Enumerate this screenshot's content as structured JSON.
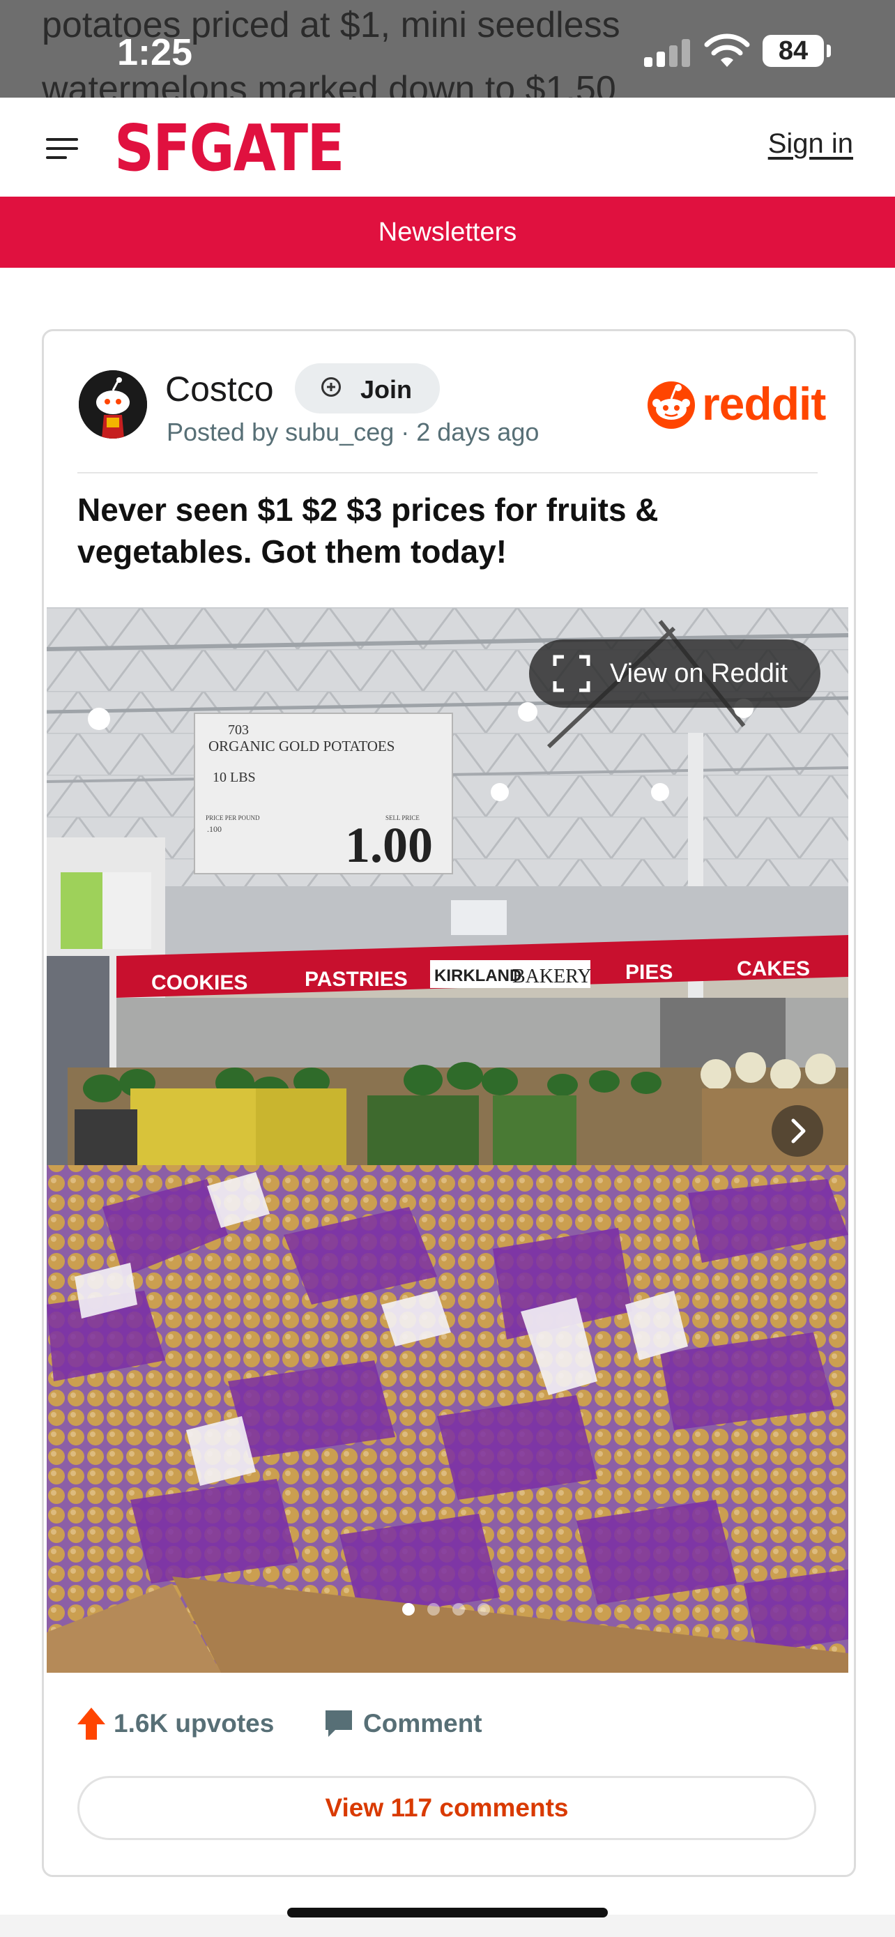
{
  "status_bar": {
    "time": "1:25",
    "battery": "84",
    "background_text_line1": "potatoes priced at $1, mini seedless",
    "background_text_line2": "watermelons marked down to $1.50"
  },
  "header": {
    "logo": "SFGATE",
    "sign_in": "Sign in",
    "brand_color": "#e0113f"
  },
  "newsletters": {
    "label": "Newsletters"
  },
  "post": {
    "community": "Costco",
    "join_label": "Join",
    "posted_by": "Posted by subu_ceg · 2 days ago",
    "brand": "reddit",
    "title": "Never seen $1 $2 $3 prices for fruits & vegetables. Got them today!",
    "photo": {
      "view_on_reddit": "View on Reddit",
      "sign_item": "703",
      "sign_product": "ORGANIC GOLD POTATOES",
      "sign_weight": "10 LBS",
      "sign_price_per_pound_label": "PRICE PER POUND",
      "sign_price_per_pound": ".100",
      "sign_sell_price_label": "SELL PRICE",
      "sign_price": "1.00",
      "banner_cookies": "COOKIES",
      "banner_pastries": "PASTRIES",
      "banner_kirkland": "KIRKLAND",
      "banner_bakery": "BAKERY",
      "banner_pies": "PIES",
      "banner_cakes": "CAKES",
      "slide_count": 4,
      "active_slide": 1
    },
    "upvotes": "1.6K upvotes",
    "comment_label": "Comment",
    "view_comments": "View 117 comments",
    "accent_color": "#ff4500"
  }
}
